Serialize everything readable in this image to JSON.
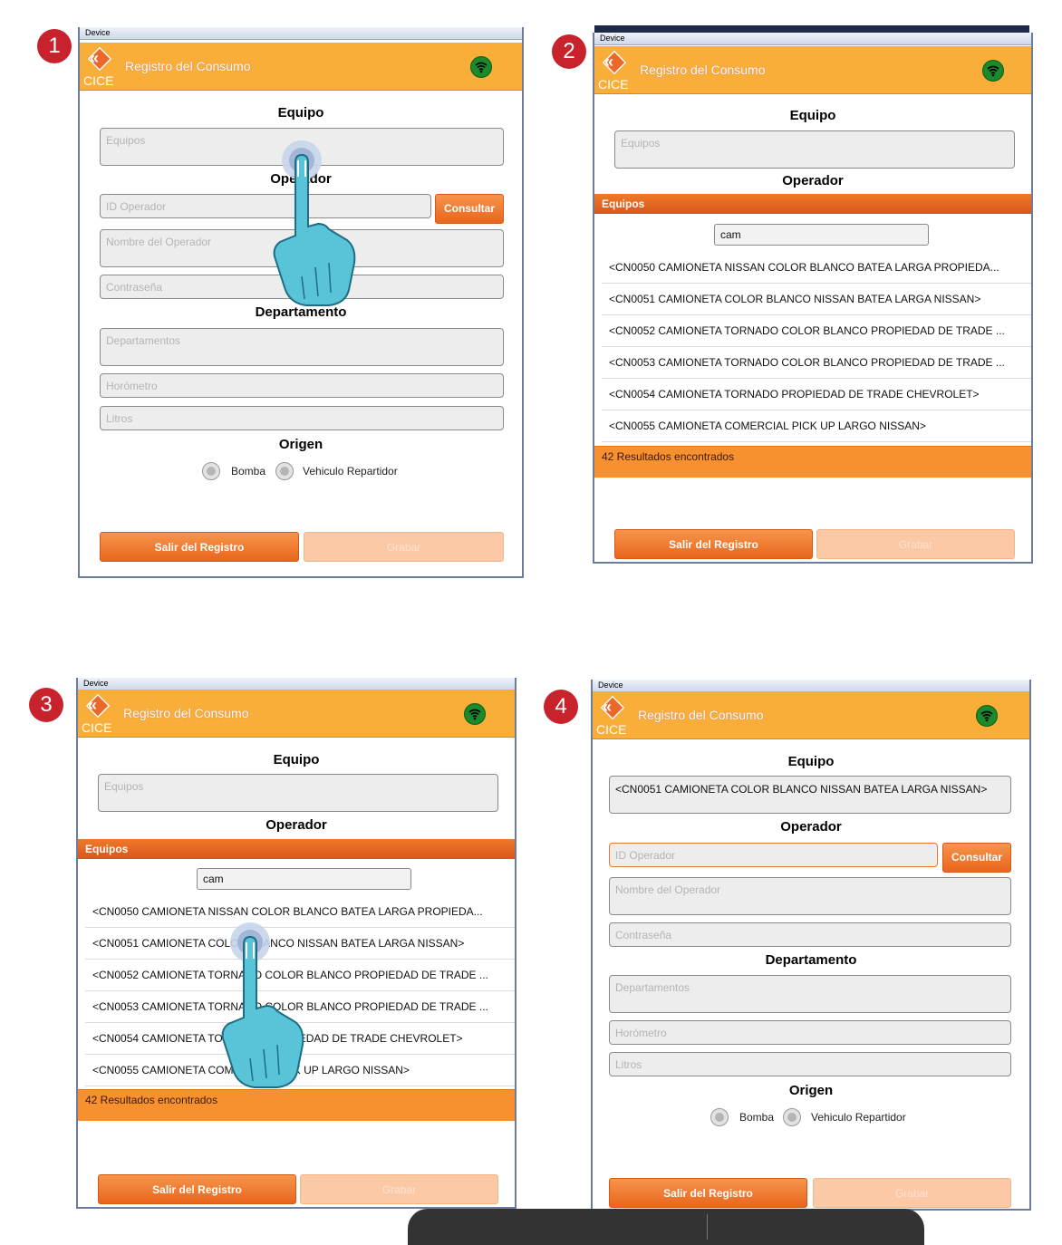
{
  "steps": [
    "1",
    "2",
    "3",
    "4"
  ],
  "device_label": "Device",
  "app_title": "Registro del Consumo",
  "logo_text": "CICE",
  "sections": {
    "equipo": "Equipo",
    "operador": "Operador",
    "departamento": "Departamento",
    "origen": "Origen"
  },
  "fields": {
    "equipos_placeholder": "Equipos",
    "id_operador_placeholder": "ID Operador",
    "nombre_operador_placeholder": "Nombre del Operador",
    "contrasena_placeholder": "Contraseña",
    "departamentos_placeholder": "Departamentos",
    "horometro_placeholder": "Horómetro",
    "litros_placeholder": "Litros",
    "equipo_selected_value": "<CN0051 CAMIONETA COLOR BLANCO NISSAN BATEA LARGA NISSAN>"
  },
  "buttons": {
    "consultar": "Consultar",
    "salir": "Salir del Registro",
    "grabar": "Grabar"
  },
  "origen_options": {
    "bomba": "Bomba",
    "vehiculo": "Vehiculo Repartidor"
  },
  "popup": {
    "title": "Equipos",
    "search_value": "cam",
    "items": [
      "<CN0050 CAMIONETA NISSAN COLOR BLANCO BATEA LARGA PROPIEDA...",
      "<CN0051 CAMIONETA COLOR BLANCO NISSAN BATEA LARGA NISSAN>",
      "<CN0052 CAMIONETA TORNADO COLOR BLANCO PROPIEDAD DE TRADE ...",
      "<CN0053 CAMIONETA TORNADO COLOR BLANCO PROPIEDAD DE TRADE ...",
      "<CN0054 CAMIONETA TORNADO PROPIEDAD DE TRADE CHEVROLET>",
      "<CN0055 CAMIONETA COMERCIAL PICK UP LARGO NISSAN>"
    ],
    "results_text": "42 Resultados encontrados"
  },
  "colors": {
    "appbar": "#f9ae3a",
    "accent_orange": "#e9651c",
    "badge_red": "#c8222c",
    "wifi_green": "#1a8a2a"
  },
  "icons": {
    "wifi": "wifi-icon",
    "logo": "cice-logo-icon",
    "hand": "tap-hand-icon"
  }
}
